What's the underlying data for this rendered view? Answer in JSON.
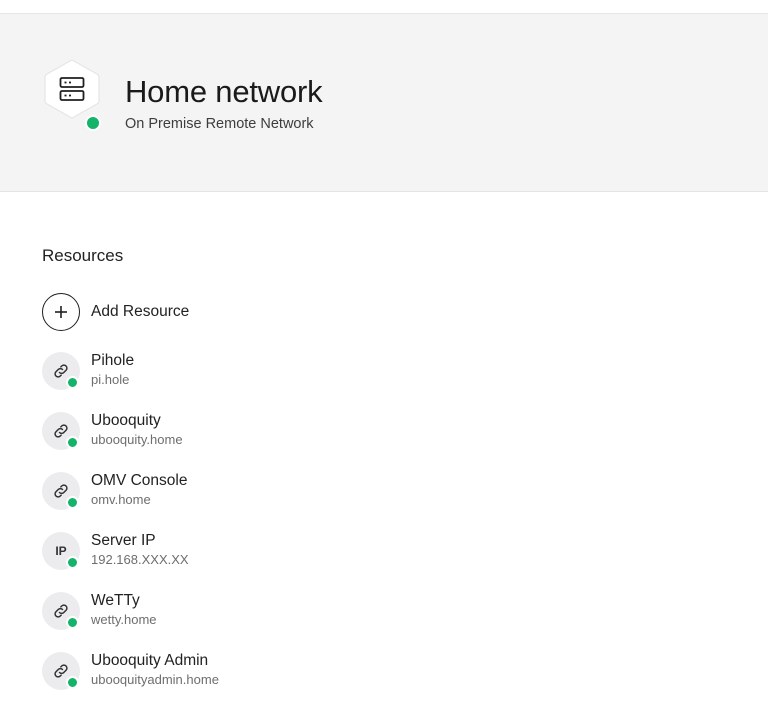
{
  "network": {
    "title": "Home network",
    "subtitle": "On Premise Remote Network",
    "icon": "server-icon",
    "status_color": "#13b36a"
  },
  "resources_section": {
    "title": "Resources",
    "add_label": "Add Resource",
    "items": [
      {
        "name": "Pihole",
        "address": "pi.hole",
        "icon": "link-icon"
      },
      {
        "name": "Ubooquity",
        "address": "ubooquity.home",
        "icon": "link-icon"
      },
      {
        "name": "OMV Console",
        "address": "omv.home",
        "icon": "link-icon"
      },
      {
        "name": "Server IP",
        "address": "192.168.XXX.XX",
        "icon": "ip-icon",
        "icon_text": "IP"
      },
      {
        "name": "WeTTy",
        "address": "wetty.home",
        "icon": "link-icon"
      },
      {
        "name": "Ubooquity Admin",
        "address": "ubooquityadmin.home",
        "icon": "link-icon"
      }
    ]
  }
}
